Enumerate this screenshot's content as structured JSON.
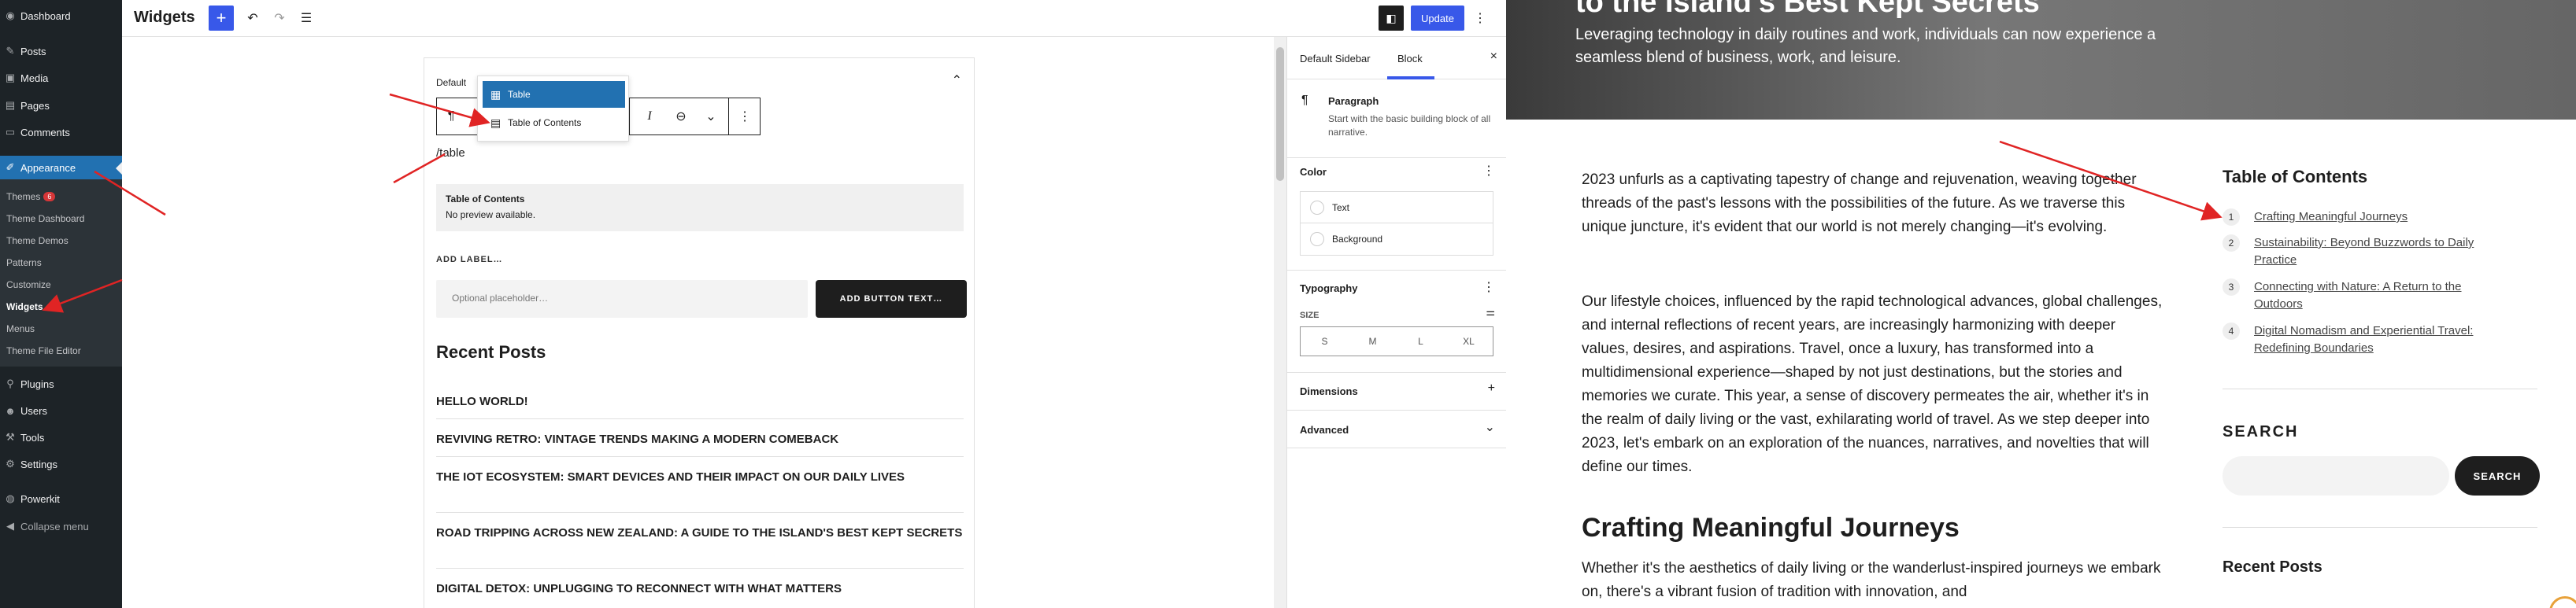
{
  "admin_menu": {
    "items": [
      {
        "icon": "dashboard-icon",
        "glyph": "◉",
        "label": "Dashboard"
      },
      {
        "icon": "pin-icon",
        "glyph": "✎",
        "label": "Posts"
      },
      {
        "icon": "media-icon",
        "glyph": "▣",
        "label": "Media"
      },
      {
        "icon": "pages-icon",
        "glyph": "▤",
        "label": "Pages"
      },
      {
        "icon": "comments-icon",
        "glyph": "▭",
        "label": "Comments"
      },
      {
        "icon": "appearance-icon",
        "glyph": "✐",
        "label": "Appearance"
      },
      {
        "icon": "plugins-icon",
        "glyph": "⚲",
        "label": "Plugins"
      },
      {
        "icon": "users-icon",
        "glyph": "☻",
        "label": "Users"
      },
      {
        "icon": "tools-icon",
        "glyph": "⚒",
        "label": "Tools"
      },
      {
        "icon": "settings-icon",
        "glyph": "⚙",
        "label": "Settings"
      },
      {
        "icon": "powerkit-icon",
        "glyph": "◍",
        "label": "Powerkit"
      },
      {
        "icon": "collapse-icon",
        "glyph": "◀",
        "label": "Collapse menu"
      }
    ],
    "submenu": [
      {
        "label": "Themes",
        "badge": "6"
      },
      {
        "label": "Theme Dashboard"
      },
      {
        "label": "Theme Demos"
      },
      {
        "label": "Patterns"
      },
      {
        "label": "Customize"
      },
      {
        "label": "Widgets"
      },
      {
        "label": "Menus"
      },
      {
        "label": "Theme File Editor"
      }
    ]
  },
  "editor": {
    "title": "Widgets",
    "add_glyph": "+",
    "undo_glyph": "↶",
    "redo_glyph": "↷",
    "list_glyph": "☰",
    "toggle_glyph": "◧",
    "update_label": "Update",
    "more_glyph": "⋮"
  },
  "canvas": {
    "area_title": "Default",
    "collapse_glyph": "⌃",
    "toolbar": {
      "paragraph_glyph": "¶",
      "italic_glyph": "I",
      "link_glyph": "⊖",
      "dropdown_glyph": "⌄",
      "more_glyph": "⋮"
    },
    "inserter": [
      {
        "glyph": "▦",
        "label": "Table"
      },
      {
        "glyph": "▤",
        "label": "Table of Contents"
      }
    ],
    "slash_text": "/table",
    "toc_placeholder": {
      "title": "Table of Contents",
      "note": "No preview available."
    },
    "add_label": "ADD LABEL…",
    "search_placeholder": "Optional placeholder…",
    "search_button": "ADD BUTTON TEXT…",
    "recent_title": "Recent Posts",
    "posts": [
      "Hello world!",
      "Reviving Retro: Vintage Trends Making a Modern Comeback",
      "The IoT Ecosystem: Smart Devices and Their Impact on Our Daily Lives",
      "Road Tripping Across New Zealand: A Guide to the Island's Best Kept Secrets",
      "Digital Detox: Unplugging to Reconnect with What Matters"
    ]
  },
  "settings": {
    "tabs": [
      "Default Sidebar",
      "Block"
    ],
    "close_glyph": "×",
    "block": {
      "glyph": "¶",
      "name": "Paragraph",
      "description": "Start with the basic building block of all narrative."
    },
    "color_title": "Color",
    "color_options": [
      "Text",
      "Background"
    ],
    "typography_title": "Typography",
    "size_label": "SIZE",
    "sizes": [
      "S",
      "M",
      "L",
      "XL"
    ],
    "dimensions_title": "Dimensions",
    "advanced_title": "Advanced",
    "more_glyph": "⋮",
    "plus_glyph": "+",
    "chevron_glyph": "⌄",
    "sliders_glyph": "⚌"
  },
  "preview": {
    "hero_title": "to the Island's Best Kept Secrets",
    "hero_subtitle": "Leveraging technology in daily routines and work, individuals can now experience a seamless blend of business, work, and leisure.",
    "paragraphs": [
      "2023 unfurls as a captivating tapestry of change and rejuvenation, weaving together threads of the past's lessons with the possibilities of the future. As we traverse this unique juncture, it's evident that our world is not merely changing—it's evolving.",
      "Our lifestyle choices, influenced by the rapid technological advances, global challenges, and internal reflections of recent years, are increasingly harmonizing with deeper values, desires, and aspirations. Travel, once a luxury, has transformed into a multidimensional experience—shaped by not just destinations, but the stories and memories we curate. This year, a sense of discovery permeates the air, whether it's in the realm of daily living or the vast, exhilarating world of travel. As we step deeper into 2023, let's embark on an exploration of the nuances, narratives, and novelties that will define our times.",
      "Whether it's the aesthetics of daily living or the wanderlust-inspired journeys we embark on, there's a vibrant fusion of tradition with innovation, and"
    ],
    "heading": "Crafting Meaningful Journeys",
    "toc_title": "Table of Contents",
    "toc_items": [
      {
        "num": "1",
        "text": "Crafting Meaningful Journeys"
      },
      {
        "num": "2",
        "text": "Sustainability: Beyond Buzzwords to Daily Practice"
      },
      {
        "num": "3",
        "text": "Connecting with Nature: A Return to the Outdoors"
      },
      {
        "num": "4",
        "text": "Digital Nomadism and Experiential Travel: Redefining Boundaries"
      }
    ],
    "search_title": "SEARCH",
    "search_button": "SEARCH",
    "recent_title": "Recent Posts"
  },
  "colors": {
    "admin_bg": "#1d2327",
    "admin_active": "#2271b1",
    "wp_blue": "#3858e9",
    "annotation_red": "#e02424"
  }
}
